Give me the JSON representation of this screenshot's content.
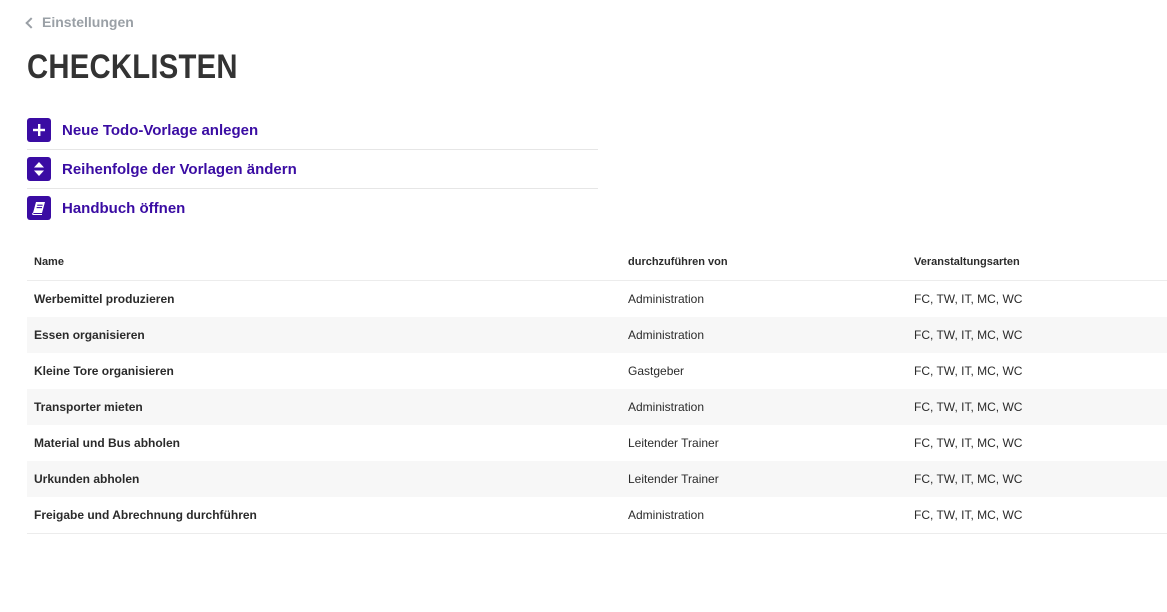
{
  "breadcrumb": {
    "label": "Einstellungen"
  },
  "page": {
    "title": "CHECKLISTEN"
  },
  "actions": [
    {
      "label": "Neue Todo-Vorlage anlegen",
      "icon": "plus-icon"
    },
    {
      "label": "Reihenfolge der Vorlagen ändern",
      "icon": "sort-icon"
    },
    {
      "label": "Handbuch öffnen",
      "icon": "book-icon"
    }
  ],
  "colors": {
    "accent": "#3a0ca3",
    "muted": "#9aa0a6",
    "row_alt": "#f7f7f7"
  },
  "table": {
    "headers": [
      "Name",
      "durchzuführen von",
      "Veranstaltungsarten"
    ],
    "rows": [
      {
        "name": "Werbemittel produzieren",
        "by": "Administration",
        "types": "FC, TW, IT, MC, WC"
      },
      {
        "name": "Essen organisieren",
        "by": "Administration",
        "types": "FC, TW, IT, MC, WC"
      },
      {
        "name": "Kleine Tore organisieren",
        "by": "Gastgeber",
        "types": "FC, TW, IT, MC, WC"
      },
      {
        "name": "Transporter mieten",
        "by": "Administration",
        "types": "FC, TW, IT, MC, WC"
      },
      {
        "name": "Material und Bus abholen",
        "by": "Leitender Trainer",
        "types": "FC, TW, IT, MC, WC"
      },
      {
        "name": "Urkunden abholen",
        "by": "Leitender Trainer",
        "types": "FC, TW, IT, MC, WC"
      },
      {
        "name": "Freigabe und Abrechnung durchführen",
        "by": "Administration",
        "types": "FC, TW, IT, MC, WC"
      }
    ]
  }
}
